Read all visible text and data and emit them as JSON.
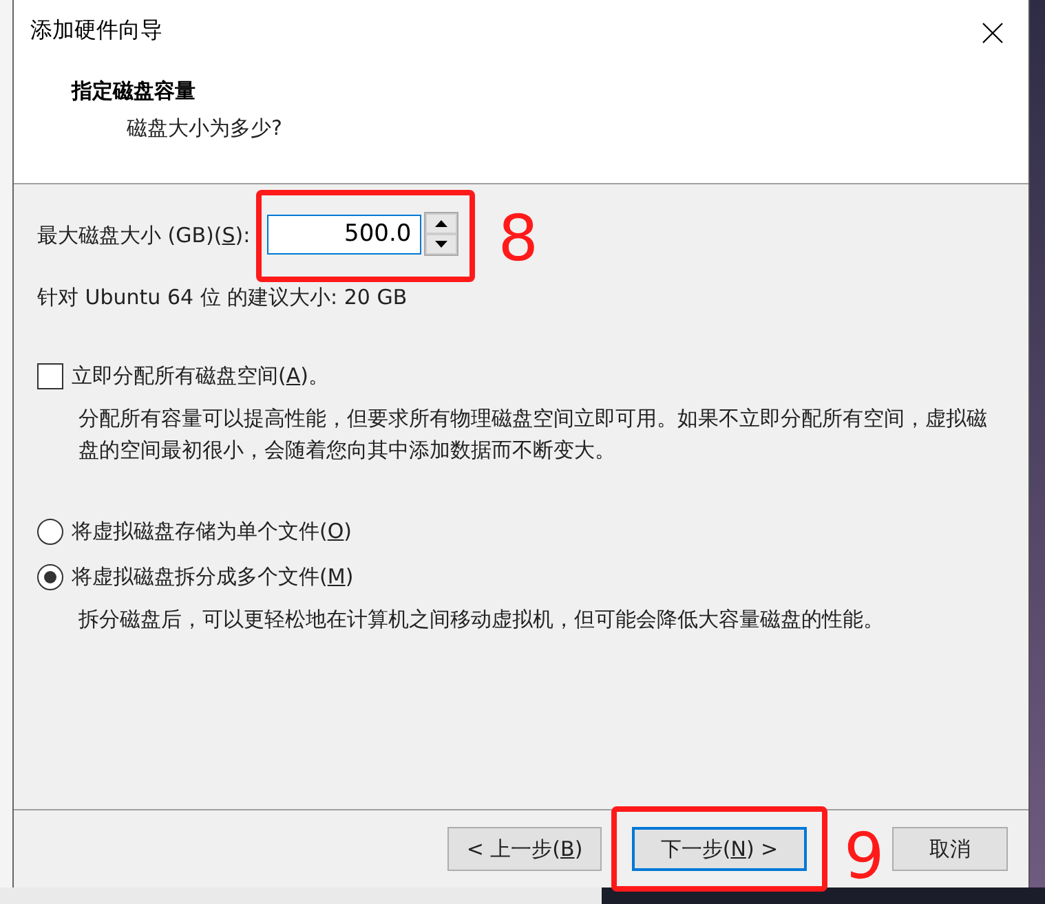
{
  "window": {
    "title": "添加硬件向导"
  },
  "header": {
    "title": "指定磁盘容量",
    "subtitle": "磁盘大小为多少?"
  },
  "disk_size": {
    "label": "最大磁盘大小 (GB)(S):",
    "value": "500.0",
    "callout": "8"
  },
  "recommendation": "针对 Ubuntu 64 位 的建议大小: 20 GB",
  "allocate": {
    "label": "立即分配所有磁盘空间(A)。",
    "checked": false,
    "description": "分配所有容量可以提高性能，但要求所有物理磁盘空间立即可用。如果不立即分配所有空间，虚拟磁盘的空间最初很小，会随着您向其中添加数据而不断变大。"
  },
  "storage_options": [
    {
      "label": "将虚拟磁盘存储为单个文件(O)",
      "selected": false
    },
    {
      "label": "将虚拟磁盘拆分成多个文件(M)",
      "selected": true,
      "description": "拆分磁盘后，可以更轻松地在计算机之间移动虚拟机，但可能会降低大容量磁盘的性能。"
    }
  ],
  "buttons": [
    {
      "label": "< 上一步(B)",
      "focused": false
    },
    {
      "label": "下一步(N) >",
      "focused": true,
      "callout": "9"
    },
    {
      "label": "取消",
      "focused": false
    }
  ]
}
